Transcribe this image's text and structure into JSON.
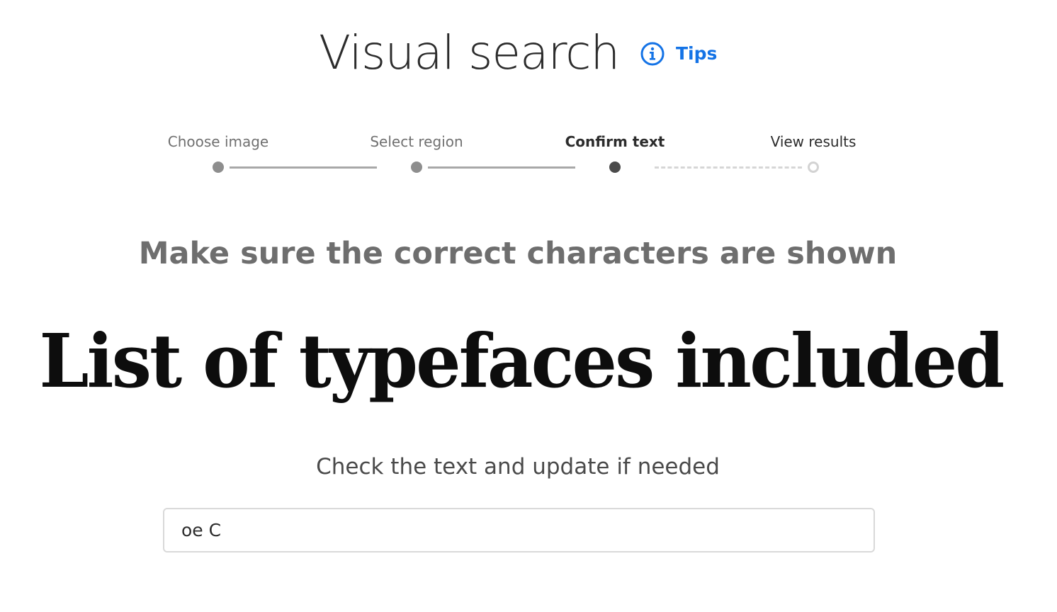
{
  "header": {
    "title": "Visual search",
    "tips_label": "Tips",
    "tips_icon": "info-icon",
    "accent_color": "#1473e6"
  },
  "stepper": {
    "steps": [
      {
        "label": "Choose image",
        "state": "done"
      },
      {
        "label": "Select region",
        "state": "done"
      },
      {
        "label": "Confirm text",
        "state": "current"
      },
      {
        "label": "View results",
        "state": "todo"
      }
    ]
  },
  "main": {
    "subheading": "Make sure the correct characters are shown",
    "preview_text": "List of typefaces included",
    "instruction": "Check the text and update if needed",
    "text_input_value": "oe C"
  }
}
